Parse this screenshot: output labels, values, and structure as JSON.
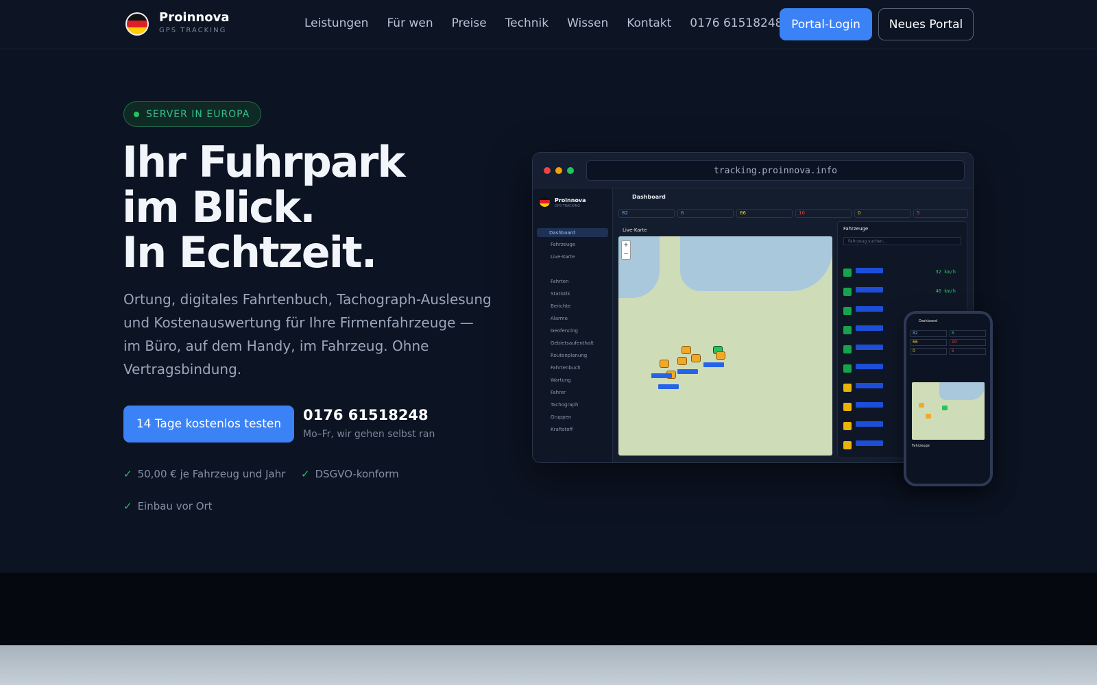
{
  "brand": {
    "name": "Proinnova",
    "tagline": "GPS TRACKING"
  },
  "nav": {
    "links": [
      "Leistungen",
      "Für wen",
      "Preise",
      "Technik",
      "Wissen",
      "Kontakt",
      "0176 61518248"
    ],
    "login": "Portal-Login",
    "new_portal": "Neues Portal"
  },
  "hero": {
    "badge": "SERVER IN EUROPA",
    "headline": [
      "Ihr Fuhrpark",
      "im Blick.",
      "In Echtzeit."
    ],
    "lead": "Ortung, digitales Fahrtenbuch, Tachograph-Auslesung und Kostenauswertung für Ihre Firmenfahrzeuge — im Büro, auf dem Handy, im Fahrzeug. Ohne Vertragsbindung.",
    "cta": "14 Tage kostenlos testen",
    "phone": "0176 61518248",
    "hours": "Mo–Fr, wir gehen selbst ran",
    "checks": [
      "50,00 € je Fahrzeug und Jahr",
      "DSGVO-konform",
      "Einbau vor Ort"
    ]
  },
  "mockup": {
    "url": "tracking.proinnova.info",
    "app_name": "Proinnova",
    "app_sub": "GPS TRACKING",
    "title": "Dashboard",
    "menu": [
      "Dashboard",
      "Fahrzeuge",
      "Live-Karte",
      "Fahrten",
      "Statistik",
      "Berichte",
      "Alarme",
      "Geofencing",
      "Gebietsaufenthalt",
      "Routenplanung",
      "Fahrtenbuch",
      "Wartung",
      "Fahrer",
      "Tachograph",
      "Gruppen",
      "Kraftstoff"
    ],
    "kpis": [
      {
        "value": "82",
        "color": "#60a5fa"
      },
      {
        "value": "6",
        "color": "#22c55e"
      },
      {
        "value": "66",
        "color": "#facc15"
      },
      {
        "value": "10",
        "color": "#ef4444"
      },
      {
        "value": "0",
        "color": "#facc15"
      },
      {
        "value": "5",
        "color": "#ef4444"
      }
    ],
    "map_title": "Live-Karte",
    "list_title": "Fahrzeuge",
    "search_placeholder": "Fahrzeug suchen...",
    "speeds": [
      "32 km/h",
      "46 km/h"
    ]
  }
}
